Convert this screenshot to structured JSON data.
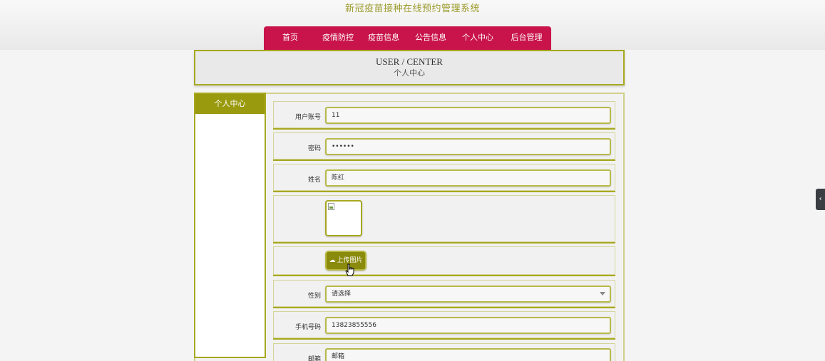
{
  "site": {
    "title": "新冠疫苗接种在线预约管理系统"
  },
  "nav": {
    "items": [
      {
        "label": "首页"
      },
      {
        "label": "疫情防控"
      },
      {
        "label": "疫苗信息"
      },
      {
        "label": "公告信息"
      },
      {
        "label": "个人中心"
      },
      {
        "label": "后台管理"
      }
    ]
  },
  "banner": {
    "title_en": "USER / CENTER",
    "title_cn": "个人中心"
  },
  "sidebar": {
    "heading": "个人中心"
  },
  "form": {
    "username": {
      "label": "用户账号",
      "value": "11"
    },
    "password": {
      "label": "密码",
      "value": "••••••"
    },
    "name": {
      "label": "姓名",
      "value": "陈红"
    },
    "upload": {
      "label": "上传图片"
    },
    "gender": {
      "label": "性别",
      "value": "请选择"
    },
    "phone": {
      "label": "手机号码",
      "value": "13823855556"
    },
    "email": {
      "label": "邮箱",
      "value": "邮箱"
    }
  },
  "colors": {
    "accent_olive": "#9a9a0e",
    "nav_crimson": "#c8144a",
    "border_olive": "#a7a81f"
  },
  "icons": {
    "upload": "cloud-upload-icon",
    "side_tab": "chevron-left-icon"
  }
}
